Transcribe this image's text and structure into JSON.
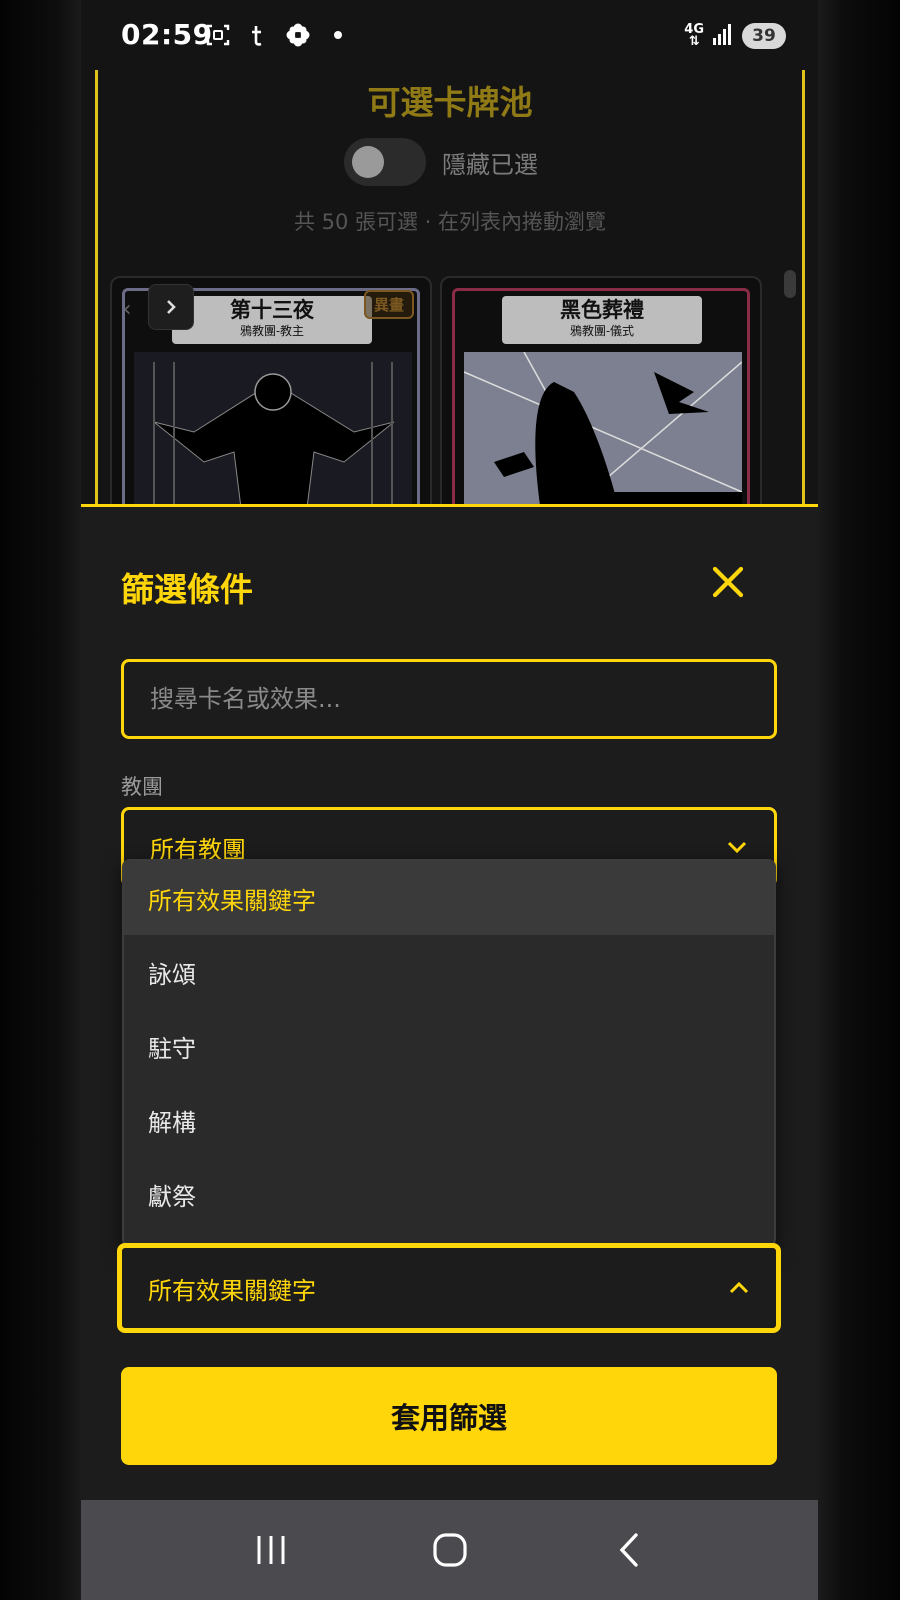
{
  "status_bar": {
    "time": "02:59",
    "network": "4G",
    "battery": "39"
  },
  "pool": {
    "title": "可選卡牌池",
    "toggle_label": "隱藏已選",
    "toggle_on": false,
    "subtitle": "共 50 張可選 · 在列表內捲動瀏覽",
    "cards": [
      {
        "name": "第十三夜",
        "subtitle": "鴉教團-教主",
        "tag": "異畫"
      },
      {
        "name": "黑色葬禮",
        "subtitle": "鴉教團-儀式"
      }
    ]
  },
  "filter": {
    "title": "篩選條件",
    "search_placeholder": "搜尋卡名或效果...",
    "tribe_label": "教團",
    "tribe_value": "所有教團",
    "keyword_value": "所有效果關鍵字",
    "keyword_options": [
      {
        "label": "所有效果關鍵字",
        "selected": true
      },
      {
        "label": "詠頌",
        "selected": false
      },
      {
        "label": "駐守",
        "selected": false
      },
      {
        "label": "解構",
        "selected": false
      },
      {
        "label": "獻祭",
        "selected": false
      }
    ],
    "apply_label": "套用篩選"
  },
  "colors": {
    "accent": "#ffd60a",
    "sheet_bg": "#1c1c1c",
    "dropdown_bg": "#2a2a2a"
  },
  "icons": [
    "screenshot-icon",
    "tumblr-icon",
    "flower-icon",
    "dot-icon",
    "signal-icon",
    "battery-icon",
    "chevron-left-icon",
    "chevron-right-icon",
    "close-icon",
    "chevron-down-icon",
    "chevron-up-icon",
    "recents-icon",
    "home-icon",
    "back-icon"
  ]
}
